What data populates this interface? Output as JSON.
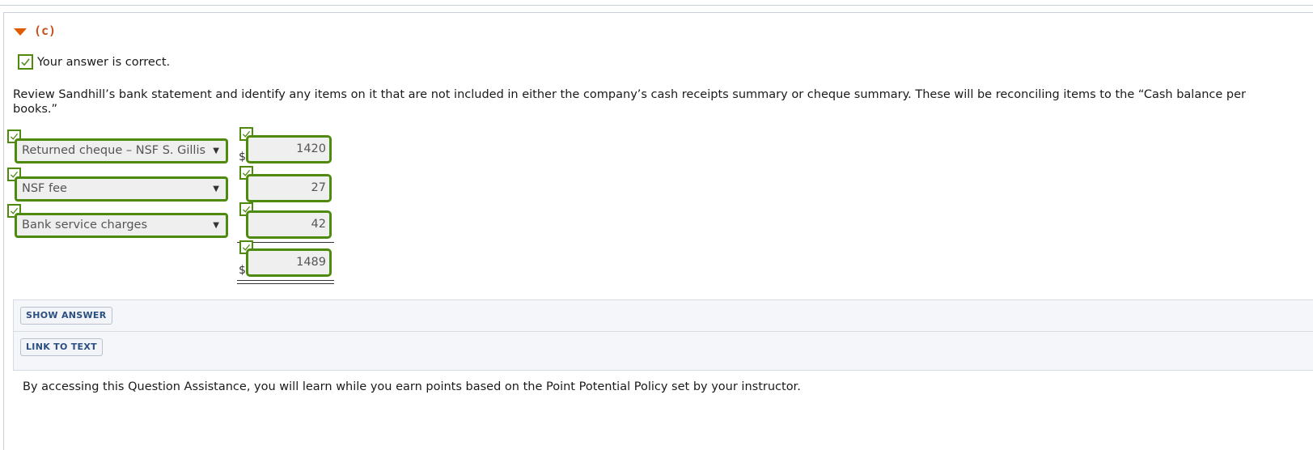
{
  "part": {
    "label": "(c)",
    "collapse_icon": "triangle-down"
  },
  "status": {
    "text": "Your answer is correct.",
    "icon": "checkmark"
  },
  "instructions": "Review Sandhill’s bank statement and identify any items on it that are not included in either the company’s cash receipts summary or cheque summary. These will be reconciling items to the “Cash balance per books.”",
  "rows": [
    {
      "item": "Returned cheque – NSF S. Gillis",
      "amount": "1420",
      "currency": "$"
    },
    {
      "item": "NSF fee",
      "amount": "27"
    },
    {
      "item": "Bank service charges",
      "amount": "42"
    }
  ],
  "total": {
    "amount": "1489",
    "currency": "$"
  },
  "buttons": {
    "show_answer": "SHOW ANSWER",
    "link_to_text": "LINK TO TEXT"
  },
  "footer": "By accessing this Question Assistance, you will learn while you earn points based on the Point Potential Policy set by your instructor.",
  "colors": {
    "correct_green": "#4e8a0e",
    "part_orange": "#e05a00",
    "button_blue": "#2a4f80"
  }
}
